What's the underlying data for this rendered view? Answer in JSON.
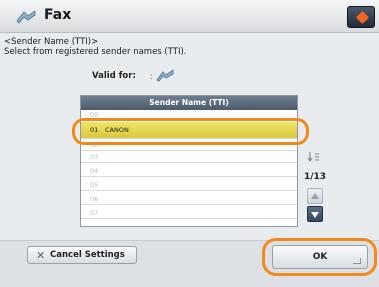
{
  "title_bar": {
    "title": "Fax"
  },
  "instructions": {
    "line1": "<Sender Name (TTI)>",
    "line2": "Select from registered sender names (TTI)."
  },
  "valid_for": {
    "label": "Valid for:",
    "colon": ":",
    "icon": "fax-icon"
  },
  "list": {
    "header": "Sender Name (TTI)",
    "rows": [
      {
        "num": "00",
        "name": ""
      },
      {
        "num": "01",
        "name": "CANON"
      },
      {
        "num": "02",
        "name": ""
      },
      {
        "num": "03",
        "name": ""
      },
      {
        "num": "04",
        "name": ""
      },
      {
        "num": "05",
        "name": ""
      },
      {
        "num": "06",
        "name": ""
      },
      {
        "num": "07",
        "name": ""
      }
    ],
    "selected_index": 1
  },
  "pagination": {
    "page": "1/13"
  },
  "footer": {
    "cancel_label": "Cancel Settings",
    "ok_label": "OK"
  },
  "colors": {
    "highlight": "#f28a1b",
    "selected_row": "#e3d64a",
    "header": "#5b6a7c"
  }
}
